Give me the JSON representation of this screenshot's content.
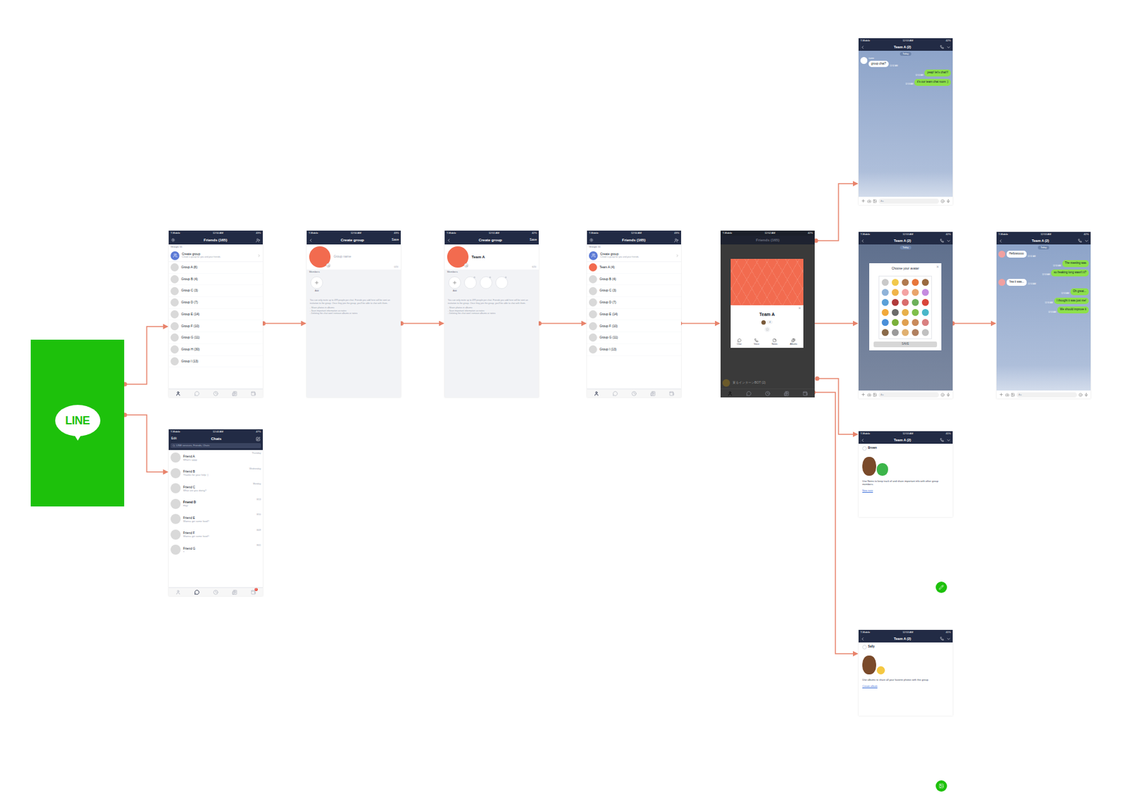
{
  "logo": {
    "text": "LINE"
  },
  "friends_screen": {
    "status": {
      "carrier": "T-Mobile",
      "time": "12:50 AM",
      "battery": "43%"
    },
    "title": "Friends (165)",
    "section": "Groups 11",
    "create": {
      "title": "Create group",
      "subtitle": "Create a group for you and your friends."
    },
    "groups": [
      {
        "name": "Group A (8)"
      },
      {
        "name": "Group B (4)"
      },
      {
        "name": "Group C (3)"
      },
      {
        "name": "Group D (7)"
      },
      {
        "name": "Group E (14)"
      },
      {
        "name": "Group F (10)"
      },
      {
        "name": "Group G (11)"
      },
      {
        "name": "Group H (30)"
      },
      {
        "name": "Group I (13)"
      }
    ],
    "tabs": [
      {
        "selected": true
      },
      {
        "selected": false
      },
      {
        "selected": false
      },
      {
        "selected": false
      },
      {
        "selected": false
      }
    ]
  },
  "chats_screen": {
    "status": {
      "carrier": "T-Mobile",
      "time": "12:44 AM",
      "battery": "47%"
    },
    "edit": "Edit",
    "title": "Chats",
    "search": {
      "placeholder": "LINE services, Friends, Chats"
    },
    "chats": [
      {
        "name": "Friend A",
        "preview": "What's uppp",
        "time": "Thursday",
        "unread": false
      },
      {
        "name": "Friend B",
        "preview": "Thanks for your help :)",
        "time": "Wednesday",
        "unread": false
      },
      {
        "name": "Friend C",
        "preview": "What are you doing?",
        "time": "Monday",
        "unread": false
      },
      {
        "name": "Friend D",
        "preview": "Hey!",
        "time": "8/13",
        "unread": true
      },
      {
        "name": "Friend E",
        "preview": "Wanna get some food?",
        "time": "8/10",
        "unread": false
      },
      {
        "name": "Friend F",
        "preview": "Wanna get some food?",
        "time": "8/09",
        "unread": false
      },
      {
        "name": "Friend G",
        "preview": "!!",
        "time": "8/01",
        "unread": false
      }
    ],
    "tabs": [
      {
        "selected": false
      },
      {
        "selected": true
      },
      {
        "selected": false
      },
      {
        "selected": false
      },
      {
        "selected": false,
        "badge": "2"
      }
    ]
  },
  "create_screen": {
    "status": {
      "carrier": "T-Mobile",
      "time": "12:50 AM",
      "battery": "43%"
    },
    "title": "Create group",
    "save": "Save",
    "name_placeholder": "Group name",
    "count": "0/20",
    "members_label": "Members",
    "add": "Add",
    "info": [
      "You can only invite up to 499 people per chat. Friends you add here will be sent an invitation to the group. Once they join the group, you'll be able to chat with them.",
      "- Share photos in albums",
      "- Save important information as notes",
      "- Deleting the chat won't remove albums or notes"
    ]
  },
  "create_named_screen": {
    "status": {
      "carrier": "T-Mobile",
      "time": "12:51 AM",
      "battery": "42%"
    },
    "title": "Create group",
    "save": "Save",
    "name": "Team A",
    "count": "6/20",
    "members_label": "Members",
    "add": "Add",
    "members": [
      {
        "name": ""
      },
      {
        "name": ""
      },
      {
        "name": ""
      }
    ],
    "info": [
      "You can only invite up to 499 people per chat. Friends you add here will be sent an invitation to the group. Once they join the group, you'll be able to chat with them.",
      "- Share photos in albums",
      "- Save important information as notes",
      "- Deleting the chat won't remove albums or notes"
    ]
  },
  "friends_team_screen": {
    "status": {
      "carrier": "T-Mobile",
      "time": "12:50 AM",
      "battery": "43%"
    },
    "title": "Friends (165)",
    "section": "Groups 11",
    "create": {
      "title": "Create group",
      "subtitle": "Create a group for you and your friends."
    },
    "groups": [
      {
        "name": "Team A (4)",
        "color": "#f26b4f"
      },
      {
        "name": "Group B (4)",
        "color": "#d9d9d9"
      },
      {
        "name": "Group C (3)",
        "color": "#d9d9d9"
      },
      {
        "name": "Group D (7)",
        "color": "#d9d9d9"
      },
      {
        "name": "Group E (14)",
        "color": "#d9d9d9"
      },
      {
        "name": "Group F (10)",
        "color": "#d9d9d9"
      },
      {
        "name": "Group G (11)",
        "color": "#d9d9d9"
      },
      {
        "name": "Group I (13)",
        "color": "#d9d9d9"
      }
    ],
    "tabs": [
      {
        "selected": true
      },
      {
        "selected": false
      },
      {
        "selected": false
      },
      {
        "selected": false
      },
      {
        "selected": false
      }
    ]
  },
  "group_modal_screen": {
    "status": {
      "carrier": "T-Mobile",
      "time": "12:52 AM",
      "battery": "42%"
    },
    "title": "Friends (165)",
    "bottom_item": "某るインターンBOT (2)",
    "close": "×",
    "card": {
      "name": "Team A",
      "members": "4",
      "actions": [
        {
          "label": "Chat"
        },
        {
          "label": "Voice"
        },
        {
          "label": "Notes"
        },
        {
          "label": "Albums"
        }
      ]
    },
    "tabs": [
      {
        "selected": true
      },
      {
        "selected": false
      },
      {
        "selected": false
      },
      {
        "selected": false
      },
      {
        "selected": false
      }
    ]
  },
  "team_chat_screen": {
    "status": {
      "carrier": "T-Mobile",
      "time": "12:53 AM",
      "battery": "42%"
    },
    "title": "Team A (2)",
    "date": "Today",
    "input_placeholder": "Aa",
    "messages": [
      {
        "side": "left",
        "sender": "name",
        "text": "group chat?",
        "time": "12:52 AM"
      },
      {
        "side": "right",
        "text": "yeap! let's chat!!!",
        "time": "12:52 AM"
      },
      {
        "side": "right",
        "text": "it's our team chat room :)",
        "time": "12:53 AM"
      }
    ]
  },
  "avatar_screen": {
    "status": {
      "carrier": "T-Mobile",
      "time": "12:53 AM",
      "battery": "42%"
    },
    "title": "Team A (2)",
    "date": "Today",
    "dialog_title": "Choose your avatar",
    "close": "×",
    "save": "SAVE",
    "input_placeholder": "Aa",
    "avatars": [
      {
        "color": "#c9c9c9"
      },
      {
        "color": "#f2c94c"
      },
      {
        "color": "#b07a4f"
      },
      {
        "color": "#e8763a"
      },
      {
        "color": "#9a6a3f"
      },
      {
        "color": "#8fb3d9"
      },
      {
        "color": "#f0b54a"
      },
      {
        "color": "#f4a3a3"
      },
      {
        "color": "#e9a46b"
      },
      {
        "color": "#c58be0"
      },
      {
        "color": "#5aa0d8"
      },
      {
        "color": "#b03a3a"
      },
      {
        "color": "#d96c6c"
      },
      {
        "color": "#6cb05a"
      },
      {
        "color": "#d9453a"
      },
      {
        "color": "#f2a93b"
      },
      {
        "color": "#6b6b6b"
      },
      {
        "color": "#e8b04a"
      },
      {
        "color": "#7fbf4a"
      },
      {
        "color": "#4ab7c9"
      },
      {
        "color": "#4a8fd9"
      },
      {
        "color": "#7ab03a"
      },
      {
        "color": "#e0a050"
      },
      {
        "color": "#c98a5a"
      },
      {
        "color": "#d98080"
      },
      {
        "color": "#8a6a4a"
      },
      {
        "color": "#9a9a9a"
      },
      {
        "color": "#e0b070"
      },
      {
        "color": "#b08060"
      },
      {
        "color": "#c0c0c0"
      }
    ]
  },
  "final_chat_screen": {
    "status": {
      "carrier": "T-Mobile",
      "time": "12:53 AM",
      "battery": "42%"
    },
    "title": "Team A (2)",
    "date": "Today",
    "input_placeholder": "Aa",
    "messages": [
      {
        "side": "left",
        "text": "Hellowoooo",
        "time": "12:52 AM"
      },
      {
        "side": "right",
        "text": "The meeting was",
        "time": "12:53 AM"
      },
      {
        "side": "right",
        "text": "so freaking long wasn't it?",
        "time": "12:53 AM"
      },
      {
        "side": "left",
        "text": "Yea it was...",
        "time": "12:53 AM"
      },
      {
        "side": "right",
        "text": "Oh great...",
        "time": "12:53 AM"
      },
      {
        "side": "right",
        "text": "I thought it was just me!",
        "time": "12:53 AM"
      },
      {
        "side": "right",
        "text": "We should improve it",
        "time": "12:53 AM"
      }
    ]
  },
  "notes_screen": {
    "status": {
      "carrier": "T-Mobile",
      "time": "12:53 AM",
      "battery": "41%"
    },
    "title": "Team A (2)",
    "user": "Brown",
    "text": "Use Notes to keep track of and share important info with other group members.",
    "link": "New note"
  },
  "albums_screen": {
    "status": {
      "carrier": "T-Mobile",
      "time": "12:53 AM",
      "battery": "41%"
    },
    "title": "Team A (2)",
    "user": "Sally",
    "text": "Use albums to share all your favorite photos with this group.",
    "link": "Create album"
  }
}
